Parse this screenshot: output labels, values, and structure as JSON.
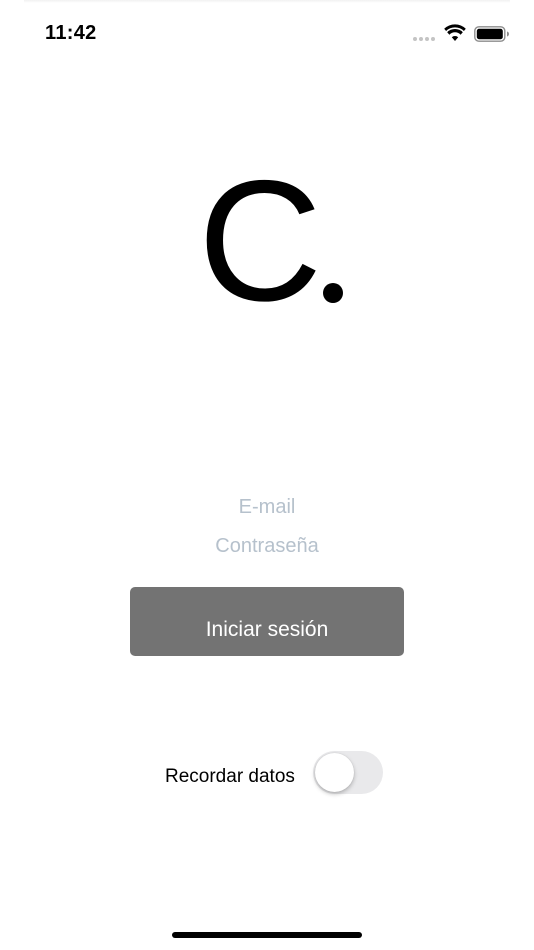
{
  "status_bar": {
    "time": "11:42",
    "icons": [
      "cellular-signal-icon",
      "wifi-icon",
      "battery-icon"
    ]
  },
  "logo": {
    "letter": "C",
    "color": "#000000"
  },
  "login_form": {
    "email_placeholder": "E-mail",
    "email_value": "",
    "password_placeholder": "Contraseña",
    "password_value": "",
    "submit_label": "Iniciar sesión",
    "submit_color": "#737373"
  },
  "remember": {
    "label": "Recordar datos",
    "enabled": false
  }
}
